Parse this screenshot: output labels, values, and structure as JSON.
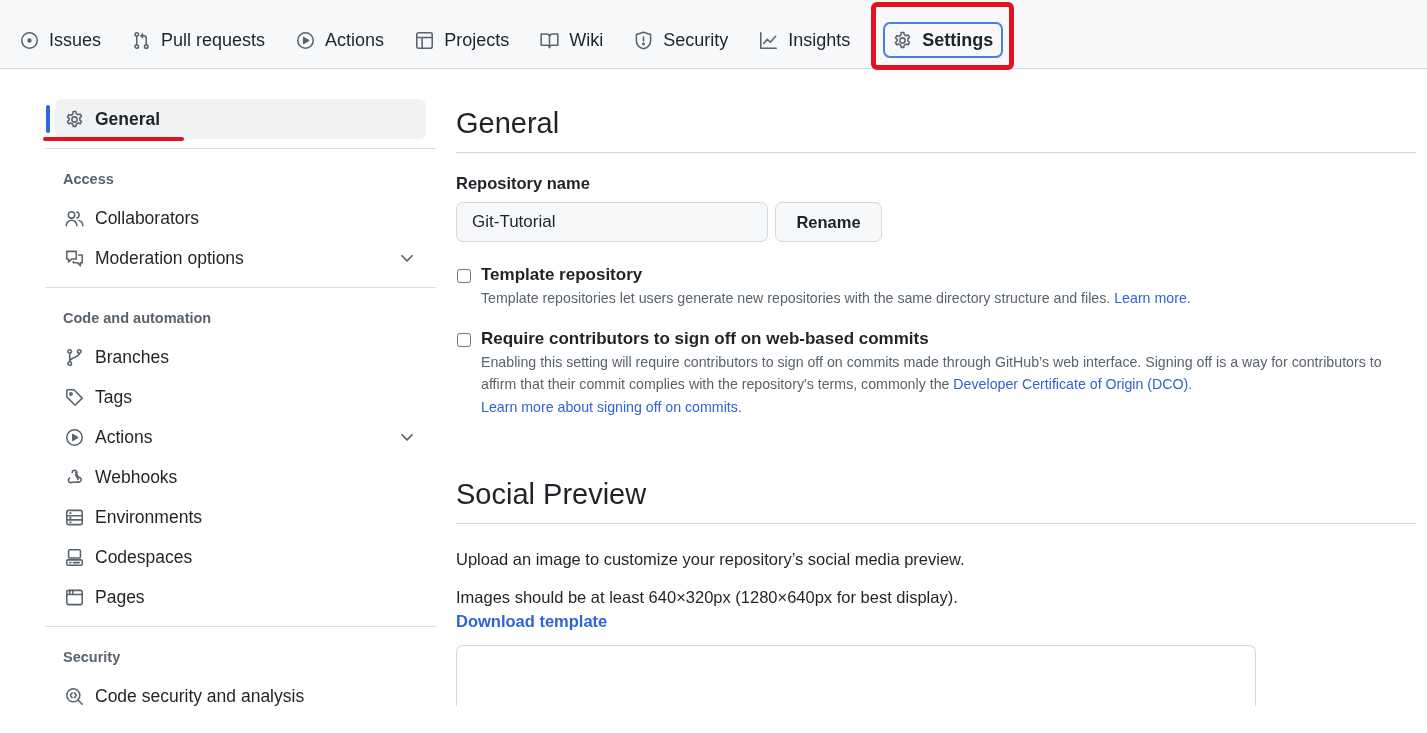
{
  "tabs": [
    {
      "label": "Issues",
      "selected": false,
      "annotated": false
    },
    {
      "label": "Pull requests",
      "selected": false,
      "annotated": false
    },
    {
      "label": "Actions",
      "selected": false,
      "annotated": false
    },
    {
      "label": "Projects",
      "selected": false,
      "annotated": false
    },
    {
      "label": "Wiki",
      "selected": false,
      "annotated": false
    },
    {
      "label": "Security",
      "selected": false,
      "annotated": false
    },
    {
      "label": "Insights",
      "selected": false,
      "annotated": false
    },
    {
      "label": "Settings",
      "selected": true,
      "annotated": true
    }
  ],
  "sidebar": {
    "groups": [
      {
        "items": [
          {
            "label": "General",
            "selected": true,
            "underlined": true,
            "has_submenu": false
          }
        ]
      },
      {
        "heading": "Access",
        "items": [
          {
            "label": "Collaborators",
            "selected": false,
            "underlined": false,
            "has_submenu": false
          },
          {
            "label": "Moderation options",
            "selected": false,
            "underlined": false,
            "has_submenu": true
          }
        ]
      },
      {
        "heading": "Code and automation",
        "items": [
          {
            "label": "Branches",
            "selected": false,
            "underlined": false,
            "has_submenu": false
          },
          {
            "label": "Tags",
            "selected": false,
            "underlined": false,
            "has_submenu": false
          },
          {
            "label": "Actions",
            "selected": false,
            "underlined": false,
            "has_submenu": true
          },
          {
            "label": "Webhooks",
            "selected": false,
            "underlined": false,
            "has_submenu": false
          },
          {
            "label": "Environments",
            "selected": false,
            "underlined": false,
            "has_submenu": false
          },
          {
            "label": "Codespaces",
            "selected": false,
            "underlined": false,
            "has_submenu": false
          },
          {
            "label": "Pages",
            "selected": false,
            "underlined": false,
            "has_submenu": false
          }
        ]
      },
      {
        "heading": "Security",
        "items": [
          {
            "label": "Code security and analysis",
            "selected": false,
            "underlined": false,
            "has_submenu": false
          }
        ]
      }
    ]
  },
  "general": {
    "title": "General",
    "repository_name": {
      "label": "Repository name",
      "value": "Git-Tutorial",
      "button": "Rename"
    },
    "options": [
      {
        "label": "Template repository",
        "checked": false,
        "description": [
          {
            "text": "Template repositories let users generate new repositories with the same directory structure and files. ",
            "link": false
          },
          {
            "text": "Learn more",
            "link": true
          },
          {
            "text": ".",
            "link": false
          }
        ]
      },
      {
        "label": "Require contributors to sign off on web-based commits",
        "checked": false,
        "description": [
          {
            "text": "Enabling this setting will require contributors to sign off on commits made through GitHub’s web interface. Signing off is a way for contributors to affirm that their commit complies with the repository's terms, commonly the ",
            "link": false
          },
          {
            "text": "Developer Certificate of Origin (DCO)",
            "link": true
          },
          {
            "text": ". ",
            "link": false
          },
          {
            "text": "Learn more about signing off on commits",
            "link": true
          },
          {
            "text": ".",
            "link": false
          }
        ]
      }
    ]
  },
  "social_preview": {
    "title": "Social Preview",
    "text": "Upload an image to customize your repository’s social media preview.",
    "size_note": "Images should be at least 640×320px (1280×640px for best display).",
    "link": "Download template"
  }
}
